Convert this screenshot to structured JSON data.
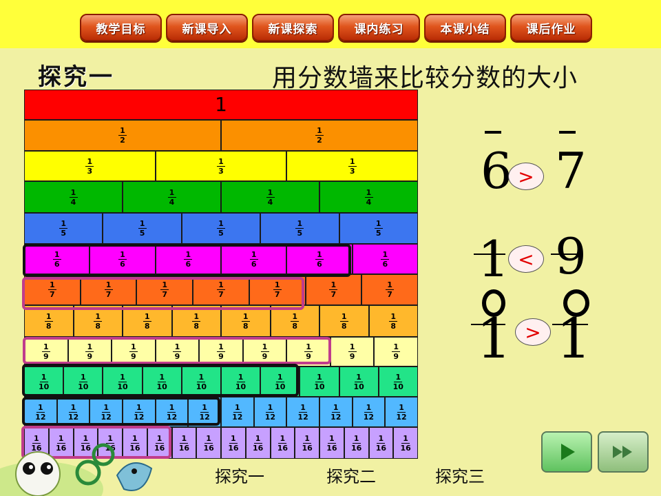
{
  "nav": [
    "教学目标",
    "新课导入",
    "新课探索",
    "课内练习",
    "本课小结",
    "课后作业"
  ],
  "heading": "探究一",
  "subheading": "用分数墙来比较分数的大小",
  "wall": {
    "whole_label": "1",
    "numerator": "1",
    "rows": [
      {
        "den": 2,
        "color": "#fb9000"
      },
      {
        "den": 3,
        "color": "#ffff00"
      },
      {
        "den": 4,
        "color": "#00b800"
      },
      {
        "den": 5,
        "color": "#3c76f0"
      },
      {
        "den": 6,
        "color": "#ff00ff"
      },
      {
        "den": 7,
        "color": "#ff6a1a"
      },
      {
        "den": 8,
        "color": "#ffb82c"
      },
      {
        "den": 9,
        "color": "#ffffa6"
      },
      {
        "den": 10,
        "color": "#22e488"
      },
      {
        "den": 12,
        "color": "#52b8ff"
      },
      {
        "den": 16,
        "color": "#c7a0ff"
      }
    ],
    "whole_color": "#ff0000"
  },
  "comparisons": [
    {
      "left": "6",
      "symbol": ">",
      "right": "7"
    },
    {
      "left": "1",
      "symbol": "<",
      "right": "9"
    },
    {
      "left": "1",
      "symbol": ">",
      "right": "1"
    }
  ],
  "footer_links": [
    "探究一",
    "探究二",
    "探究三"
  ],
  "icons": {
    "play": "play-icon",
    "fast_forward": "fast-forward-icon"
  }
}
